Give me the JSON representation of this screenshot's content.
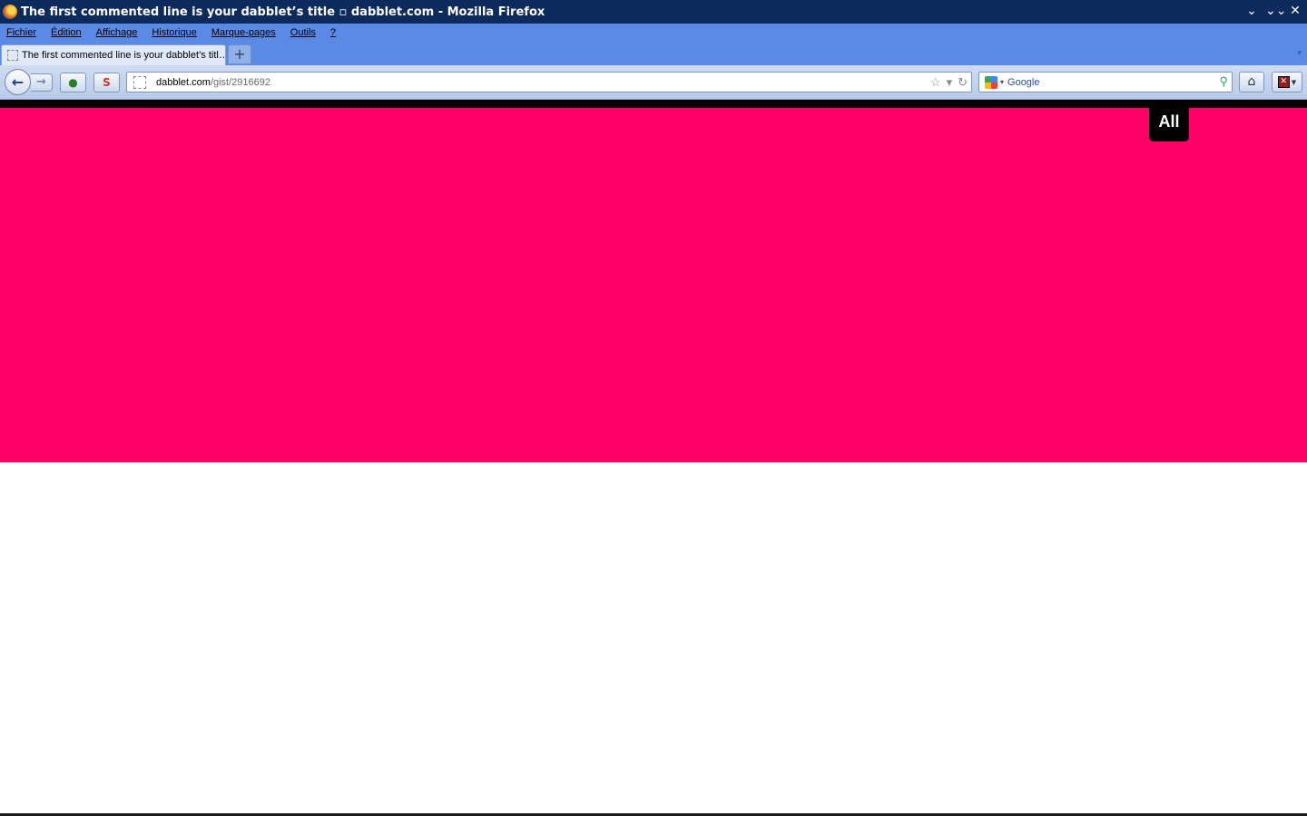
{
  "window": {
    "title": "The first commented line is your dabblet’s title ▫ dabblet.com - Mozilla Firefox",
    "controls": [
      "⌄",
      "⌄⌄",
      "✕"
    ]
  },
  "menubar": {
    "items": [
      "Fichier",
      "Édition",
      "Affichage",
      "Historique",
      "Marque-pages",
      "Outils",
      "?"
    ]
  },
  "tabs": {
    "active_label": "The first commented line is your dabblet’s titl…",
    "new_tab_label": "+",
    "dropdown_label": "▾"
  },
  "navbar": {
    "back_label": "←",
    "forward_label": "→",
    "url_domain": "dabblet.com",
    "url_path": "/gist/2916692",
    "bookmark_star": "☆",
    "history_drop": "▾",
    "reload": "↻",
    "search_engine": "Google",
    "search_drop": "▾",
    "search_icon": "⚲",
    "home_icon": "⌂"
  },
  "page": {
    "view_toggle_label": "All",
    "colors": {
      "result_background": "#ff0066",
      "toolbar_background": "#000000"
    }
  }
}
